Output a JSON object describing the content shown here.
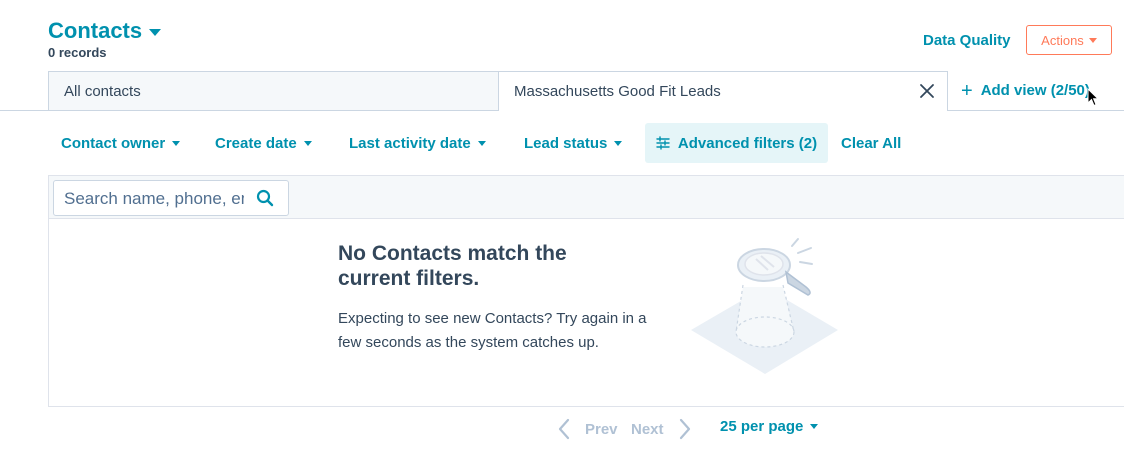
{
  "header": {
    "title": "Contacts",
    "record_count": "0 records",
    "data_quality_label": "Data Quality",
    "actions_label": "Actions"
  },
  "views": {
    "tabs": [
      {
        "label": "All contacts"
      },
      {
        "label": "Massachusetts Good Fit Leads"
      }
    ],
    "add_view_label": "Add view (2/50)"
  },
  "filters": {
    "items": [
      {
        "label": "Contact owner"
      },
      {
        "label": "Create date"
      },
      {
        "label": "Last activity date"
      },
      {
        "label": "Lead status"
      }
    ],
    "advanced_label": "Advanced filters (2)",
    "clear_all_label": "Clear All"
  },
  "search": {
    "placeholder": "Search name, phone, email"
  },
  "empty_state": {
    "title": "No Contacts match the current filters.",
    "description": "Expecting to see new Contacts? Try again in a few seconds as the system catches up."
  },
  "pagination": {
    "prev_label": "Prev",
    "next_label": "Next",
    "per_page_label": "25 per page"
  },
  "colors": {
    "accent": "#0091ae",
    "action": "#ff7a59",
    "text": "#33475b",
    "disabled": "#b0c1d4"
  }
}
